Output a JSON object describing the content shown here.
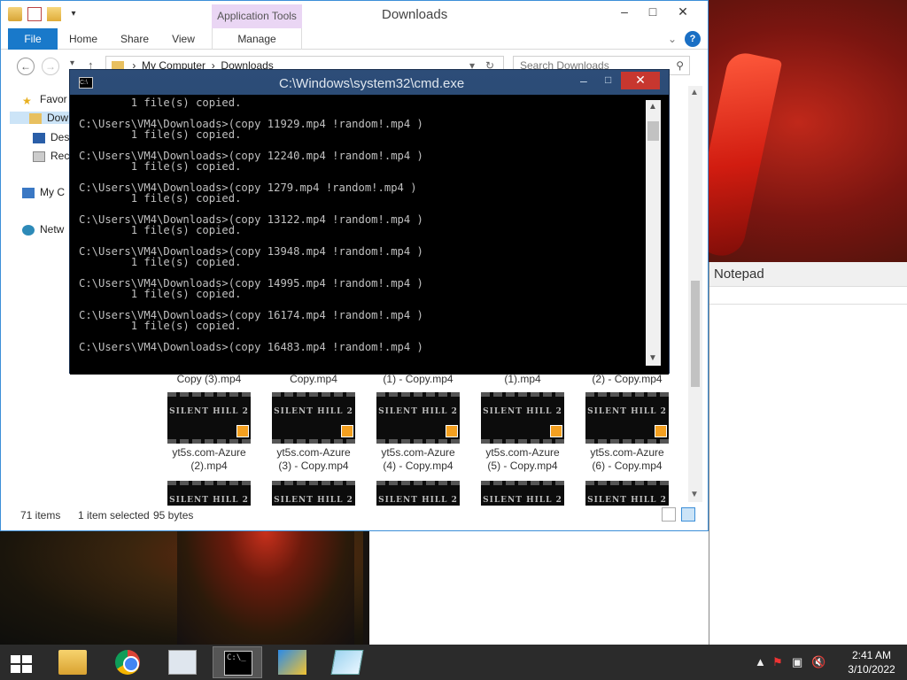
{
  "explorer": {
    "title": "Downloads",
    "contextual_tab_group": "Application Tools",
    "tabs": [
      "File",
      "Home",
      "Share",
      "View",
      "Manage"
    ],
    "breadcrumb": [
      "My Computer",
      "Downloads"
    ],
    "search_placeholder": "Search Downloads",
    "nav_items": [
      "Favor",
      "Dow",
      "Des",
      "Rec",
      "My C",
      "Netw"
    ],
    "file_captions_row1": [
      "Copy (3).mp4",
      "Copy.mp4",
      "(1) - Copy.mp4",
      "(1).mp4",
      "(2) - Copy.mp4"
    ],
    "file_captions_row2": [
      [
        "yt5s.com-Azure",
        "(2).mp4"
      ],
      [
        "yt5s.com-Azure",
        "(3) - Copy.mp4"
      ],
      [
        "yt5s.com-Azure",
        "(4) - Copy.mp4"
      ],
      [
        "yt5s.com-Azure",
        "(5) - Copy.mp4"
      ],
      [
        "yt5s.com-Azure",
        "(6) - Copy.mp4"
      ]
    ],
    "thumb_text": "SILENT HILL 2",
    "status": {
      "items": "71 items",
      "selected": "1 item selected",
      "size": "95 bytes"
    }
  },
  "cmd": {
    "title": "C:\\Windows\\system32\\cmd.exe",
    "lines": [
      "        1 file(s) copied.",
      "",
      "C:\\Users\\VM4\\Downloads>(copy 11929.mp4 !random!.mp4 )",
      "        1 file(s) copied.",
      "",
      "C:\\Users\\VM4\\Downloads>(copy 12240.mp4 !random!.mp4 )",
      "        1 file(s) copied.",
      "",
      "C:\\Users\\VM4\\Downloads>(copy 1279.mp4 !random!.mp4 )",
      "        1 file(s) copied.",
      "",
      "C:\\Users\\VM4\\Downloads>(copy 13122.mp4 !random!.mp4 )",
      "        1 file(s) copied.",
      "",
      "C:\\Users\\VM4\\Downloads>(copy 13948.mp4 !random!.mp4 )",
      "        1 file(s) copied.",
      "",
      "C:\\Users\\VM4\\Downloads>(copy 14995.mp4 !random!.mp4 )",
      "        1 file(s) copied.",
      "",
      "C:\\Users\\VM4\\Downloads>(copy 16174.mp4 !random!.mp4 )",
      "        1 file(s) copied.",
      "",
      "C:\\Users\\VM4\\Downloads>(copy 16483.mp4 !random!.mp4 )"
    ]
  },
  "notepad": {
    "title": "Notepad"
  },
  "taskbar": {
    "time": "2:41 AM",
    "date": "3/10/2022",
    "apps": [
      "File Explorer",
      "Google Chrome",
      "Performance Monitor",
      "Command Prompt",
      "Kdenlive",
      "Notepad"
    ]
  },
  "colors": {
    "accent": "#1979ca",
    "close_red": "#c7372f",
    "contextual_tab": "#ead6f4",
    "taskbar": "#2b2b2b"
  }
}
